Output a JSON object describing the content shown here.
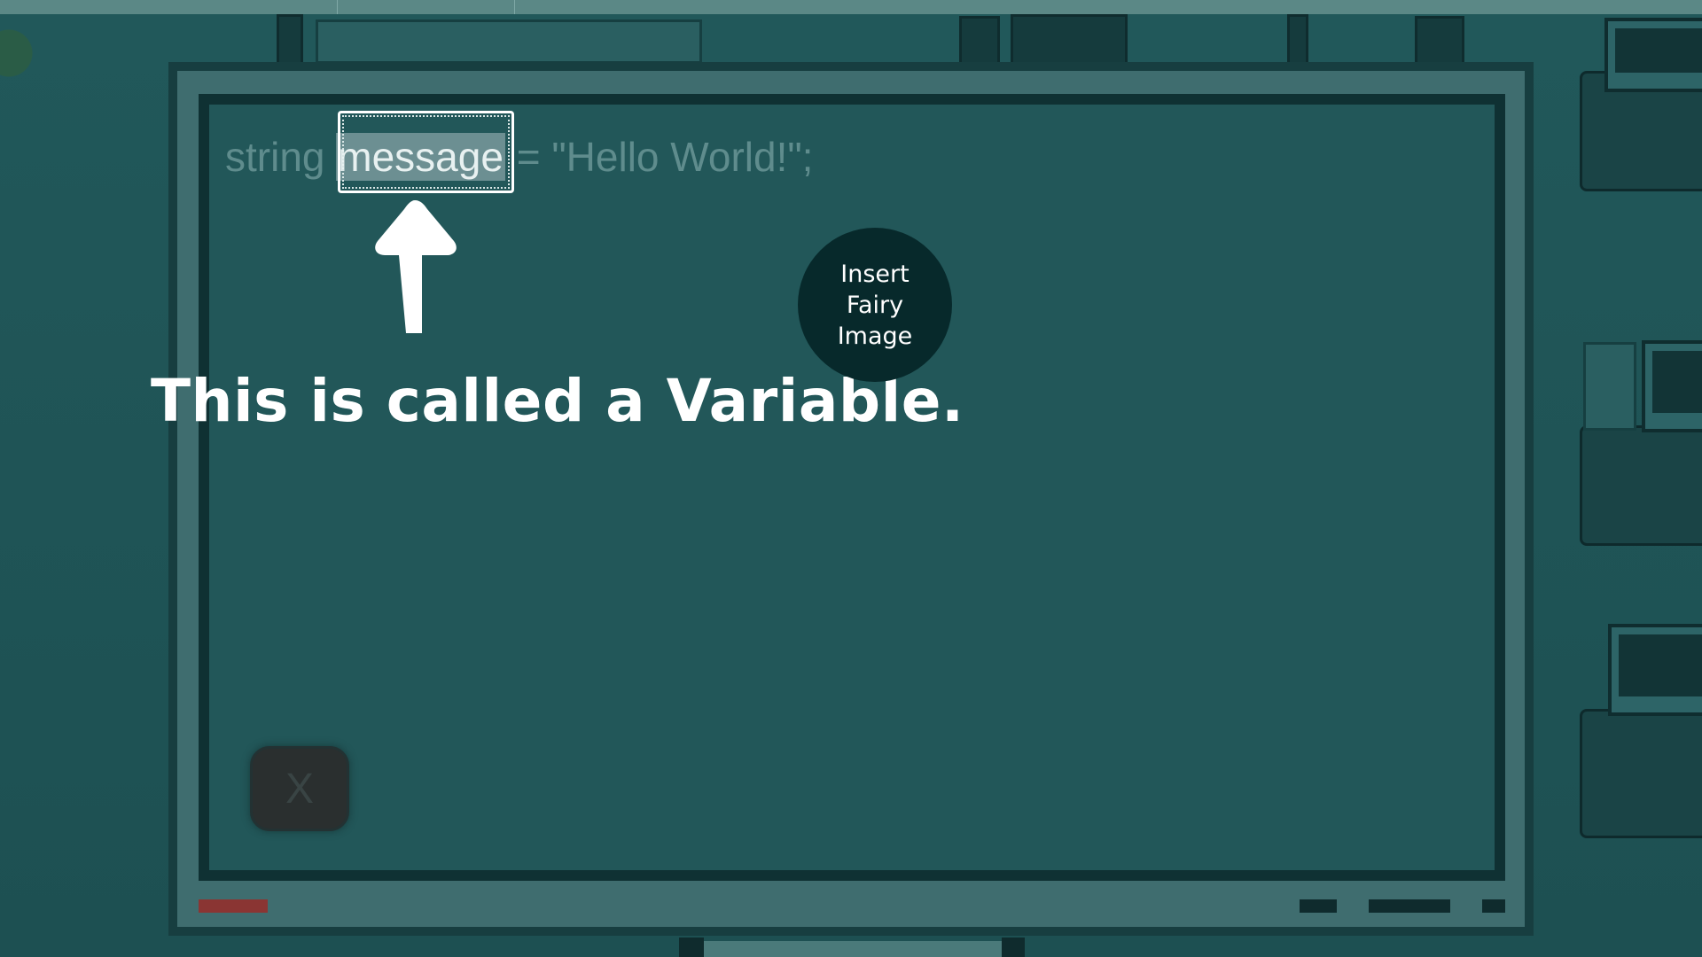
{
  "code": {
    "keyword": "string",
    "variable_name": "message",
    "rest": "= \"Hello World!\";"
  },
  "caption": "This is called a Variable.",
  "placeholder": {
    "text": "Insert\nFairy\nImage"
  },
  "close_button": {
    "label": "X",
    "icon": "close-icon"
  },
  "colors": {
    "background": "#1f5557",
    "board": "#225759",
    "board_frame": "#0f3133",
    "highlight": "#6c8f92",
    "caption": "#ffffff",
    "placeholder_circle": "#07292b",
    "tray_red": "#8a3533"
  }
}
